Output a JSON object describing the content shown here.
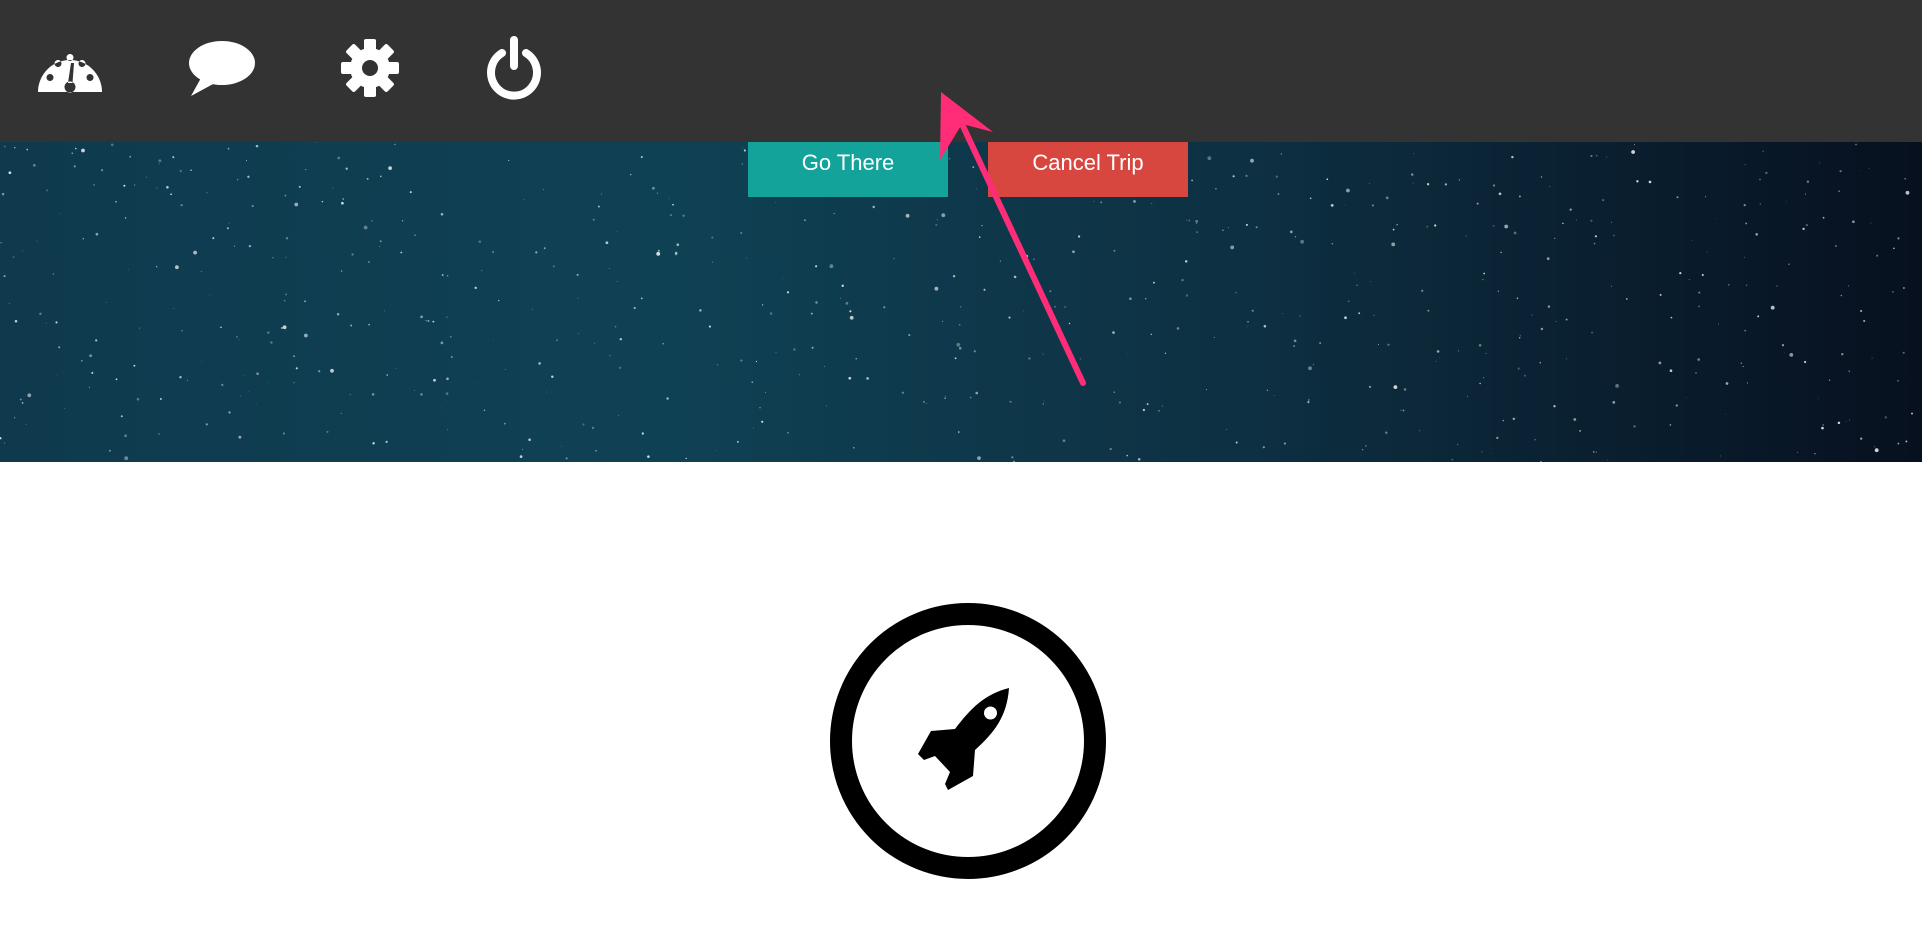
{
  "nav": {
    "items": [
      {
        "icon": "dashboard-gauge-icon"
      },
      {
        "icon": "chat-bubble-icon"
      },
      {
        "icon": "gear-icon"
      },
      {
        "icon": "power-icon"
      }
    ]
  },
  "actions": {
    "go_label": "Go There",
    "cancel_label": "Cancel Trip"
  },
  "hero": {
    "background": "starfield"
  },
  "badge": {
    "icon": "rocket-icon"
  },
  "annotation": {
    "icon": "pointer-arrow-icon",
    "color": "#ff2d77"
  },
  "colors": {
    "topbar": "#333333",
    "go_button": "#13a39b",
    "cancel_button": "#d8473f",
    "hero_dark": "#0f3a4e"
  }
}
